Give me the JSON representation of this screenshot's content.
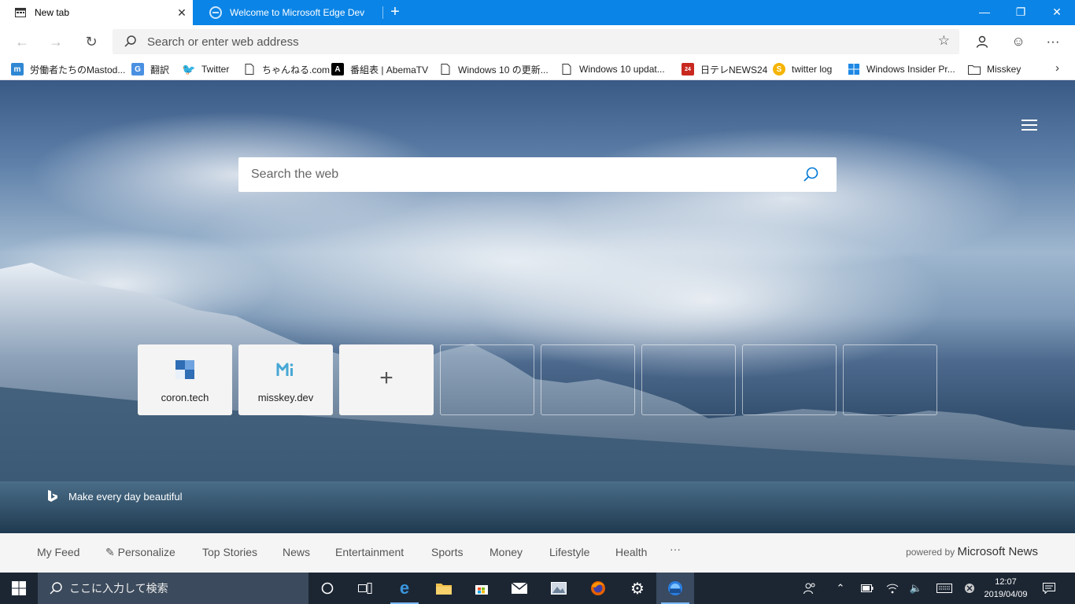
{
  "tabs": [
    {
      "title": "New tab",
      "active": true
    },
    {
      "title": "Welcome to Microsoft Edge Dev",
      "active": false
    }
  ],
  "window_controls": [
    "minimize",
    "restore",
    "close"
  ],
  "address_bar": {
    "placeholder": "Search or enter web address"
  },
  "favorites": [
    {
      "label": "労働者たちのMastod...",
      "icon": "mastodon-icon",
      "color": "#3088d4"
    },
    {
      "label": "翻訳",
      "icon": "translate-icon",
      "color": "#4a90e2"
    },
    {
      "label": "Twitter",
      "icon": "twitter-icon",
      "color": "#1da1f2"
    },
    {
      "label": "ちゃんねる.com",
      "icon": "page-icon",
      "color": "#ffffff"
    },
    {
      "label": "番組表 | AbemaTV",
      "icon": "abema-icon",
      "color": "#000000"
    },
    {
      "label": "Windows 10 の更新...",
      "icon": "page-icon",
      "color": "#ffffff"
    },
    {
      "label": "Windows 10 updat...",
      "icon": "page-icon",
      "color": "#ffffff"
    },
    {
      "label": "日テレNEWS24",
      "icon": "news24-icon",
      "color": "#c8281e"
    },
    {
      "label": "twitter log",
      "icon": "s-icon",
      "color": "#f5b400"
    },
    {
      "label": "Windows Insider Pr...",
      "icon": "windows-icon",
      "color": "#1e88e5"
    },
    {
      "label": "Misskey",
      "icon": "folder-icon",
      "color": "#ffffff"
    }
  ],
  "ntp": {
    "search_placeholder": "Search the web",
    "tiles": [
      {
        "label": "coron.tech",
        "type": "site"
      },
      {
        "label": "misskey.dev",
        "type": "site"
      },
      {
        "label": "+",
        "type": "add"
      }
    ],
    "bing_caption": "Make every day beautiful"
  },
  "news_nav": {
    "items": [
      "My Feed",
      "Personalize",
      "Top Stories",
      "News",
      "Entertainment",
      "Sports",
      "Money",
      "Lifestyle",
      "Health",
      "···"
    ],
    "powered_by": "powered by",
    "brand": "Microsoft News"
  },
  "taskbar": {
    "search_text": "ここに入力して検索",
    "time": "12:07",
    "date": "2019/04/09"
  }
}
